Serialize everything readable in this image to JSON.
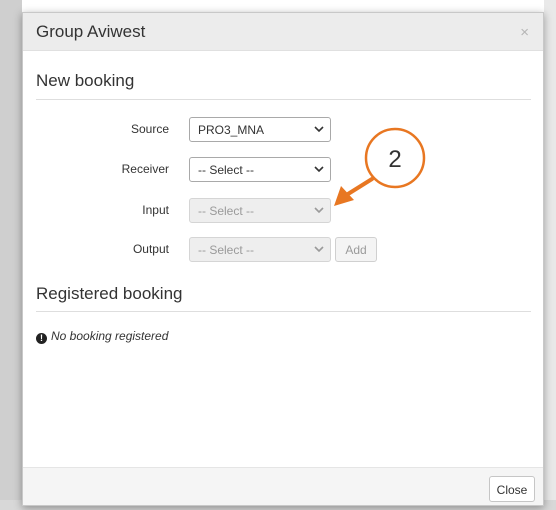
{
  "modal": {
    "title": "Group Aviwest",
    "close_glyph": "×"
  },
  "new_booking": {
    "title": "New booking",
    "source": {
      "label": "Source",
      "value": "PRO3_MNA"
    },
    "receiver": {
      "label": "Receiver",
      "value": "-- Select --"
    },
    "input": {
      "label": "Input",
      "value": "-- Select --"
    },
    "output": {
      "label": "Output",
      "value": "-- Select --"
    },
    "add_label": "Add"
  },
  "registered_booking": {
    "title": "Registered booking",
    "info_glyph": "!",
    "empty_text": "No booking registered"
  },
  "footer": {
    "close_label": "Close"
  },
  "annotation": {
    "step": "2",
    "color": "#e87722"
  },
  "icons": {
    "dropdown": "chevron-down-icon",
    "info": "exclamation-circle-icon"
  }
}
